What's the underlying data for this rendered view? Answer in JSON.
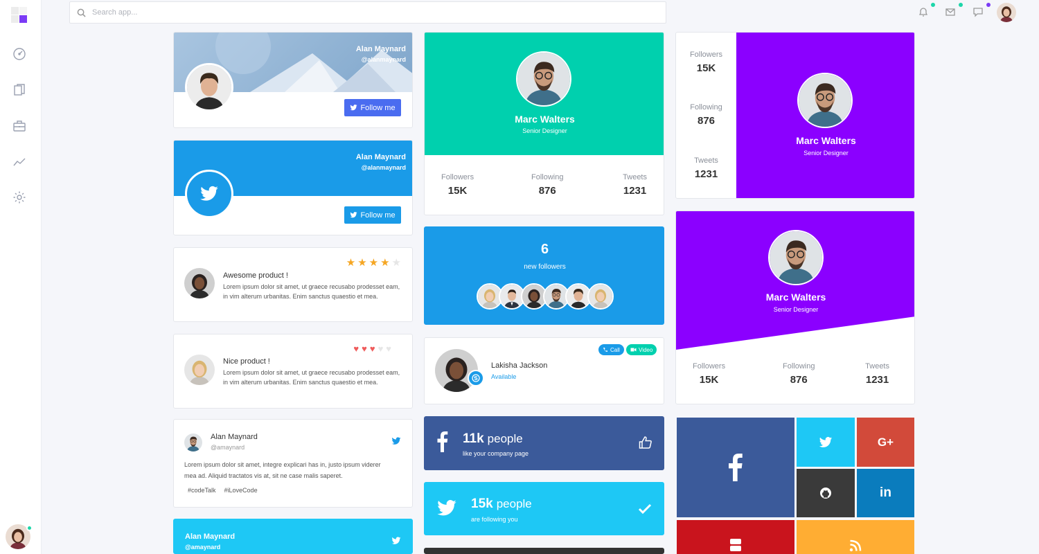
{
  "search": {
    "placeholder": "Search app..."
  },
  "colors": {
    "accent": "#7b3bf5",
    "online": "#1dd6a9",
    "twitter": "#1a9be8",
    "teal": "#00d0ae",
    "purple": "#8b00ff",
    "facebook": "#3b5a9a"
  },
  "sidebar": {
    "icons": [
      "dashboard-icon",
      "documents-icon",
      "briefcase-icon",
      "trend-icon",
      "settings-icon"
    ]
  },
  "topbar": {
    "icons": [
      "bell-icon",
      "mail-icon",
      "chat-icon"
    ]
  },
  "card1": {
    "name": "Alan Maynard",
    "handle": "@alanmaynard",
    "button": "Follow me"
  },
  "card2": {
    "name": "Alan Maynard",
    "handle": "@alanmaynard",
    "button": "Follow me"
  },
  "review1": {
    "title": "Awesome product !",
    "text": "Lorem ipsum dolor sit amet, ut graece recusabo prodesset eam, in vim alterum urbanitas. Enim sanctus quaestio et mea.",
    "rating": 4,
    "max": 5
  },
  "review2": {
    "title": "Nice product !",
    "text": "Lorem ipsum dolor sit amet, ut graece recusabo prodesset eam, in vim alterum urbanitas. Enim sanctus quaestio et mea.",
    "rating": 3,
    "max": 5
  },
  "tweet": {
    "name": "Alan Maynard",
    "handle": "@amaynard",
    "text": "Lorem ipsum dolor sit amet, integre explicari has in, justo ipsum viderer mea ad. Aliquid tractatos vis at, sit ne case malis saperet.",
    "tags": [
      "#codeTalk",
      "#iLoveCode"
    ]
  },
  "card_bottom": {
    "name": "Alan Maynard",
    "handle": "@amaynard"
  },
  "profile_teal": {
    "name": "Marc Walters",
    "role": "Senior Designer",
    "followers_label": "Followers",
    "followers": "15K",
    "following_label": "Following",
    "following": "876",
    "tweets_label": "Tweets",
    "tweets": "1231"
  },
  "new_followers": {
    "count": "6",
    "label": "new followers"
  },
  "contact": {
    "name": "Lakisha Jackson",
    "status": "Available",
    "call": "Call",
    "video": "Video"
  },
  "fb_stat": {
    "count": "11k",
    "unit": "people",
    "sub": "like your company page"
  },
  "tw_stat": {
    "count": "15k",
    "unit": "people",
    "sub": "are following you"
  },
  "profile_side": {
    "name": "Marc Walters",
    "role": "Senior Designer",
    "followers_label": "Followers",
    "followers": "15K",
    "following_label": "Following",
    "following": "876",
    "tweets_label": "Tweets",
    "tweets": "1231"
  },
  "profile_purple": {
    "name": "Marc Walters",
    "role": "Senior Designer",
    "followers_label": "Followers",
    "followers": "15K",
    "following_label": "Following",
    "following": "876",
    "tweets_label": "Tweets",
    "tweets": "1231"
  },
  "social_tiles": [
    "facebook-icon",
    "twitter-icon",
    "google-plus-icon",
    "github-icon",
    "linkedin-icon",
    "youtube-icon",
    "rss-icon"
  ]
}
